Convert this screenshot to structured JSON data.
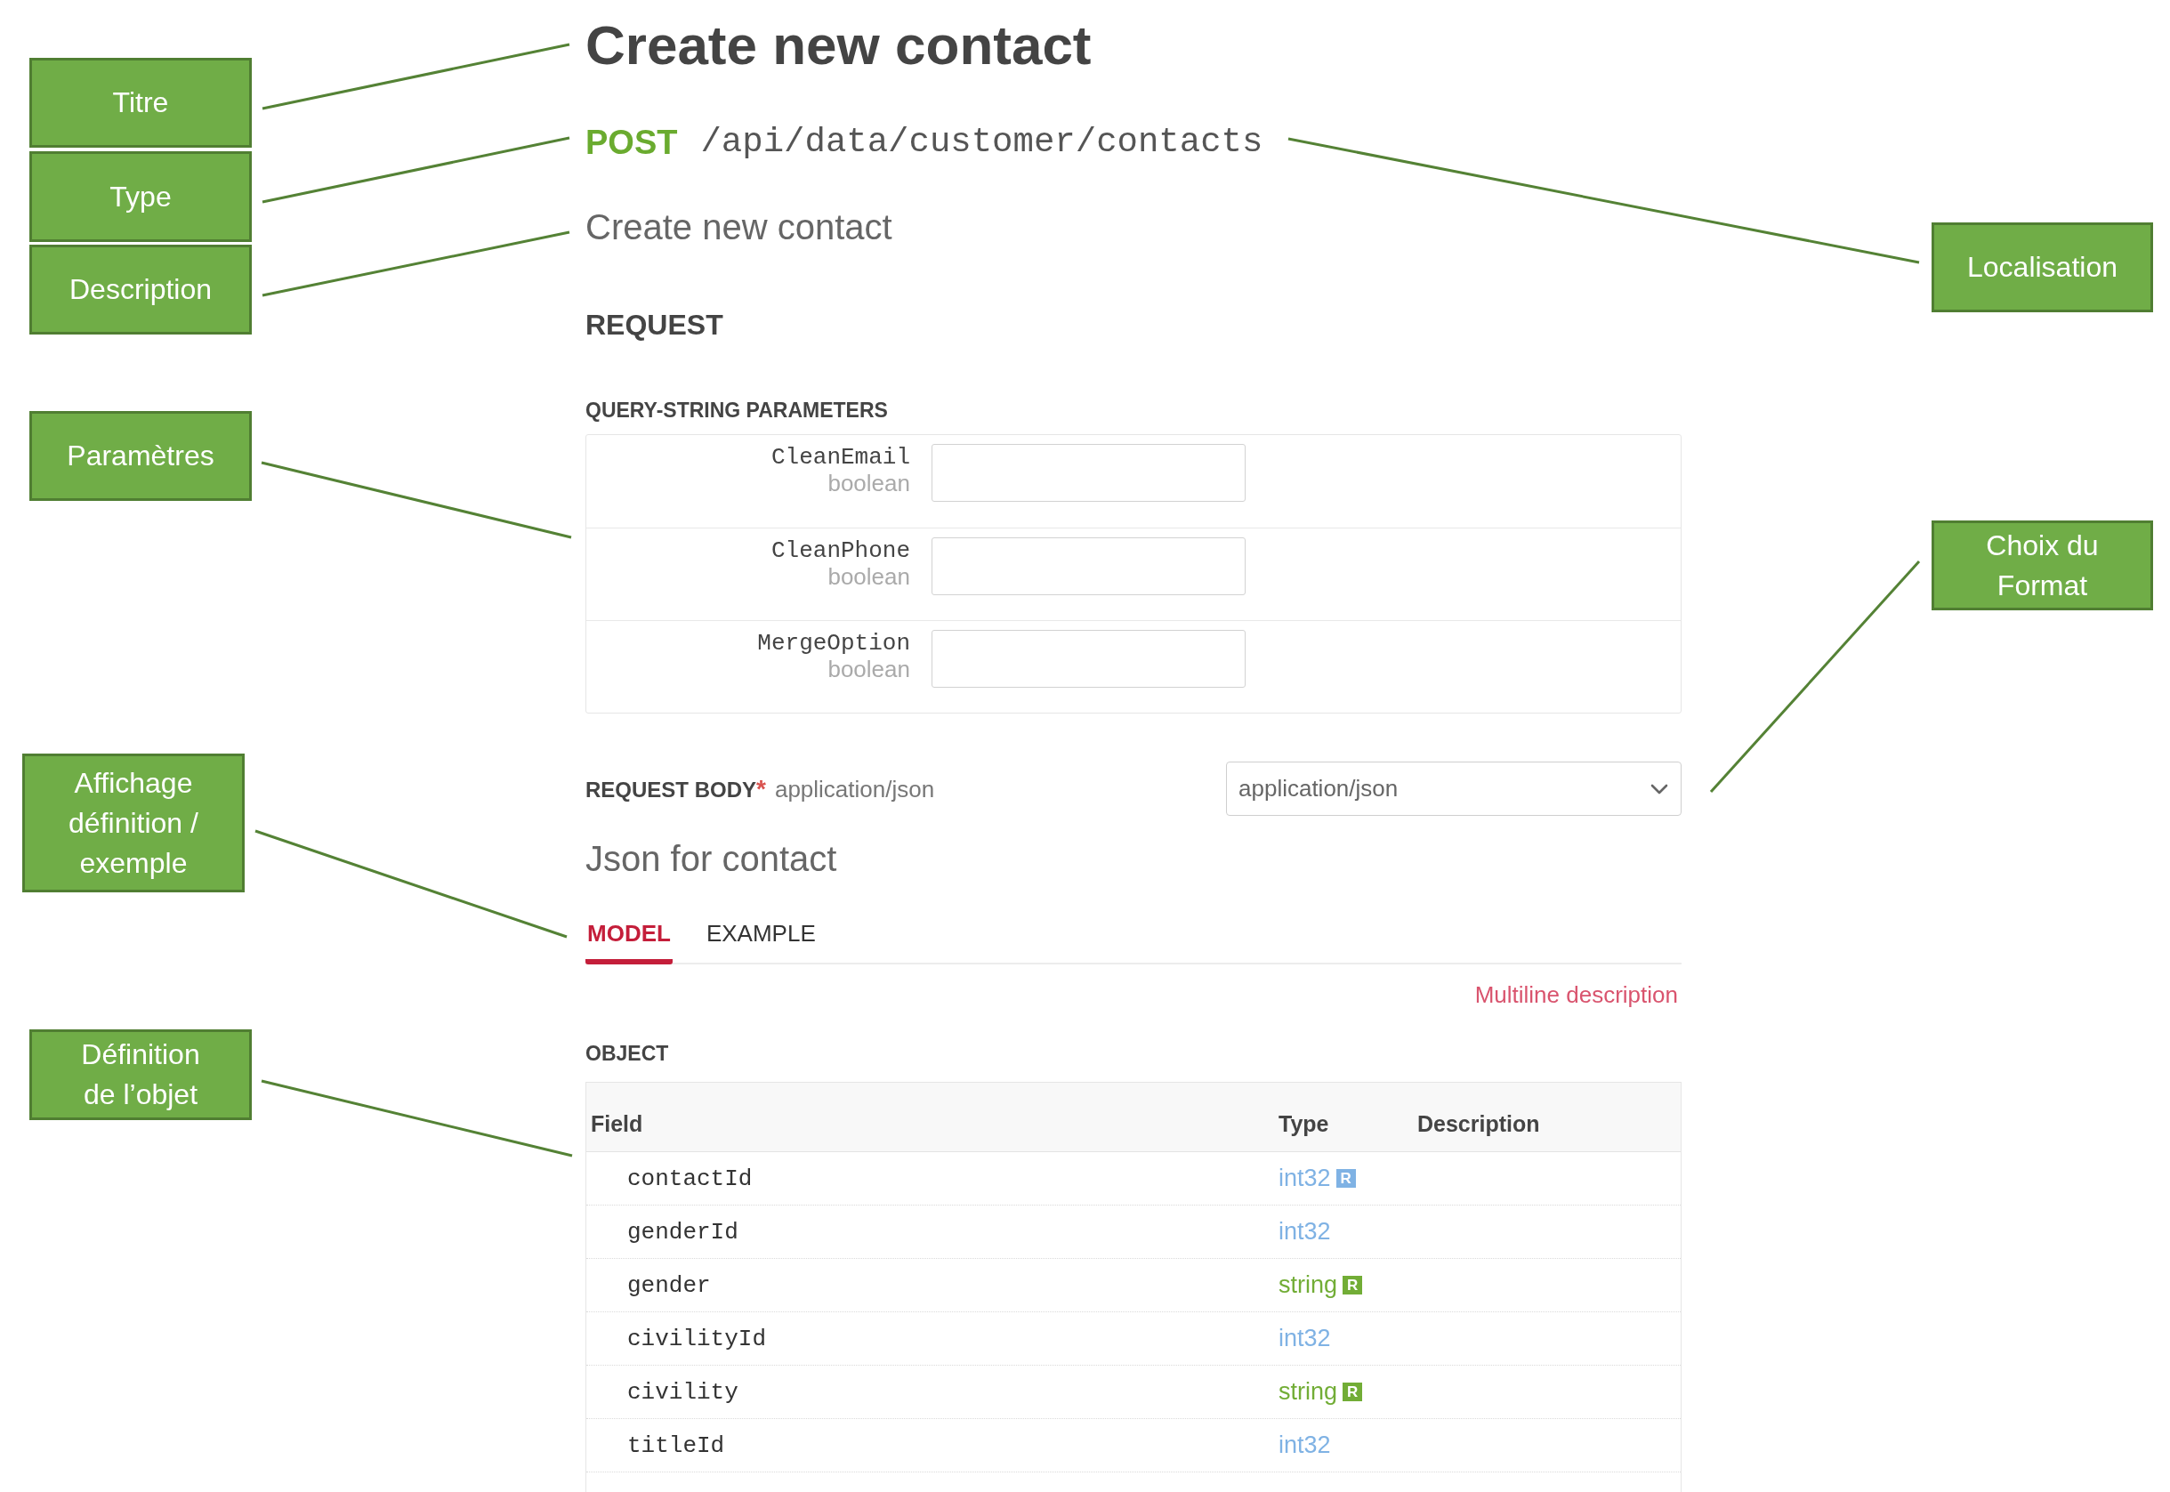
{
  "annotations": [
    {
      "label": "Titre"
    },
    {
      "label": "Type"
    },
    {
      "label": "Description"
    },
    {
      "label": "Paramètres"
    },
    {
      "label": "Affichage définition / exemple"
    },
    {
      "label": "Définition de l’objet"
    },
    {
      "label": "Localisation"
    },
    {
      "label": "Choix du Format"
    }
  ],
  "endpoint": {
    "title": "Create new contact",
    "method": "POST",
    "path": "/api/data/customer/contacts",
    "description": "Create new contact"
  },
  "request": {
    "heading": "REQUEST",
    "query_parameters": {
      "heading": "QUERY-STRING PARAMETERS",
      "items": [
        {
          "name": "CleanEmail",
          "type": "boolean"
        },
        {
          "name": "CleanPhone",
          "type": "boolean"
        },
        {
          "name": "MergeOption",
          "type": "boolean"
        }
      ]
    },
    "body": {
      "label": "REQUEST BODY",
      "required_mark": "*",
      "content_type": "application/json",
      "format_select": {
        "value": "application/json"
      },
      "title": "Json for contact",
      "tabs": [
        {
          "label": "MODEL",
          "selected": true
        },
        {
          "label": "EXAMPLE",
          "selected": false
        }
      ],
      "description_link": "Multiline description",
      "object": {
        "heading": "OBJECT",
        "columns": [
          "Field",
          "Type",
          "Description"
        ],
        "rows": [
          {
            "field": "contactId",
            "type": "int32",
            "color": "#7fb2e4",
            "badge": "R"
          },
          {
            "field": "genderId",
            "type": "int32",
            "color": "#7fb2e4"
          },
          {
            "field": "gender",
            "type": "string",
            "color": "#72ad36",
            "badge": "R"
          },
          {
            "field": "civilityId",
            "type": "int32",
            "color": "#7fb2e4"
          },
          {
            "field": "civility",
            "type": "string",
            "color": "#72ad36",
            "badge": "R"
          },
          {
            "field": "titleId",
            "type": "int32",
            "color": "#7fb2e4"
          }
        ]
      }
    }
  }
}
